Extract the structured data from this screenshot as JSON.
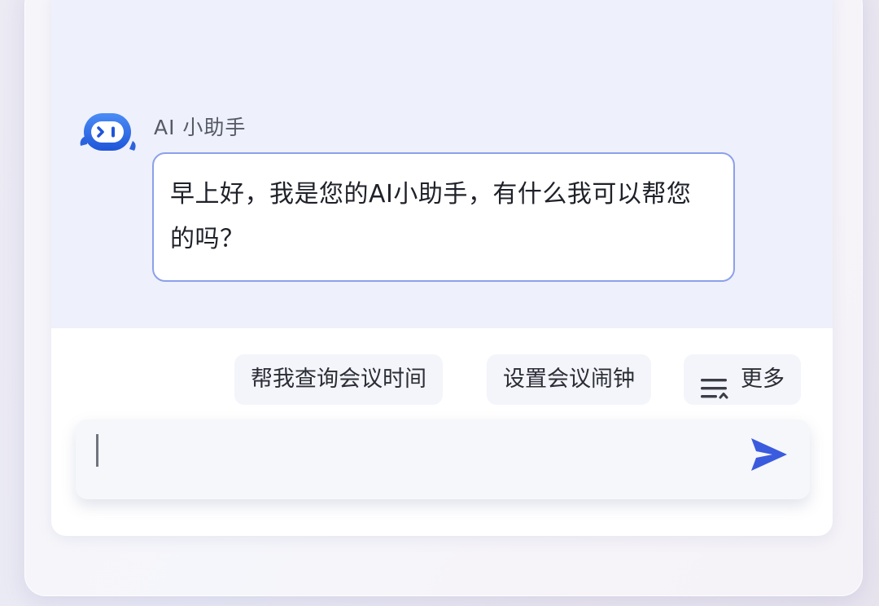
{
  "assistant": {
    "name": "AI 小助手",
    "avatar_icon": "robot-avatar-icon",
    "brand_color": "#2f6ee8"
  },
  "messages": [
    {
      "from": "assistant",
      "text": "早上好，我是您的AI小助手，有什么我可以帮您的吗？",
      "border_color": "#8ca0ea"
    }
  ],
  "quick_actions": {
    "items": [
      {
        "label": "帮我查询会议时间"
      },
      {
        "label": "设置会议闹钟"
      },
      {
        "label": "更多",
        "icon": "menu-lines-icon"
      }
    ]
  },
  "composer": {
    "value": "",
    "send_icon": "send-arrow-icon",
    "send_color": "#3b5bde"
  }
}
